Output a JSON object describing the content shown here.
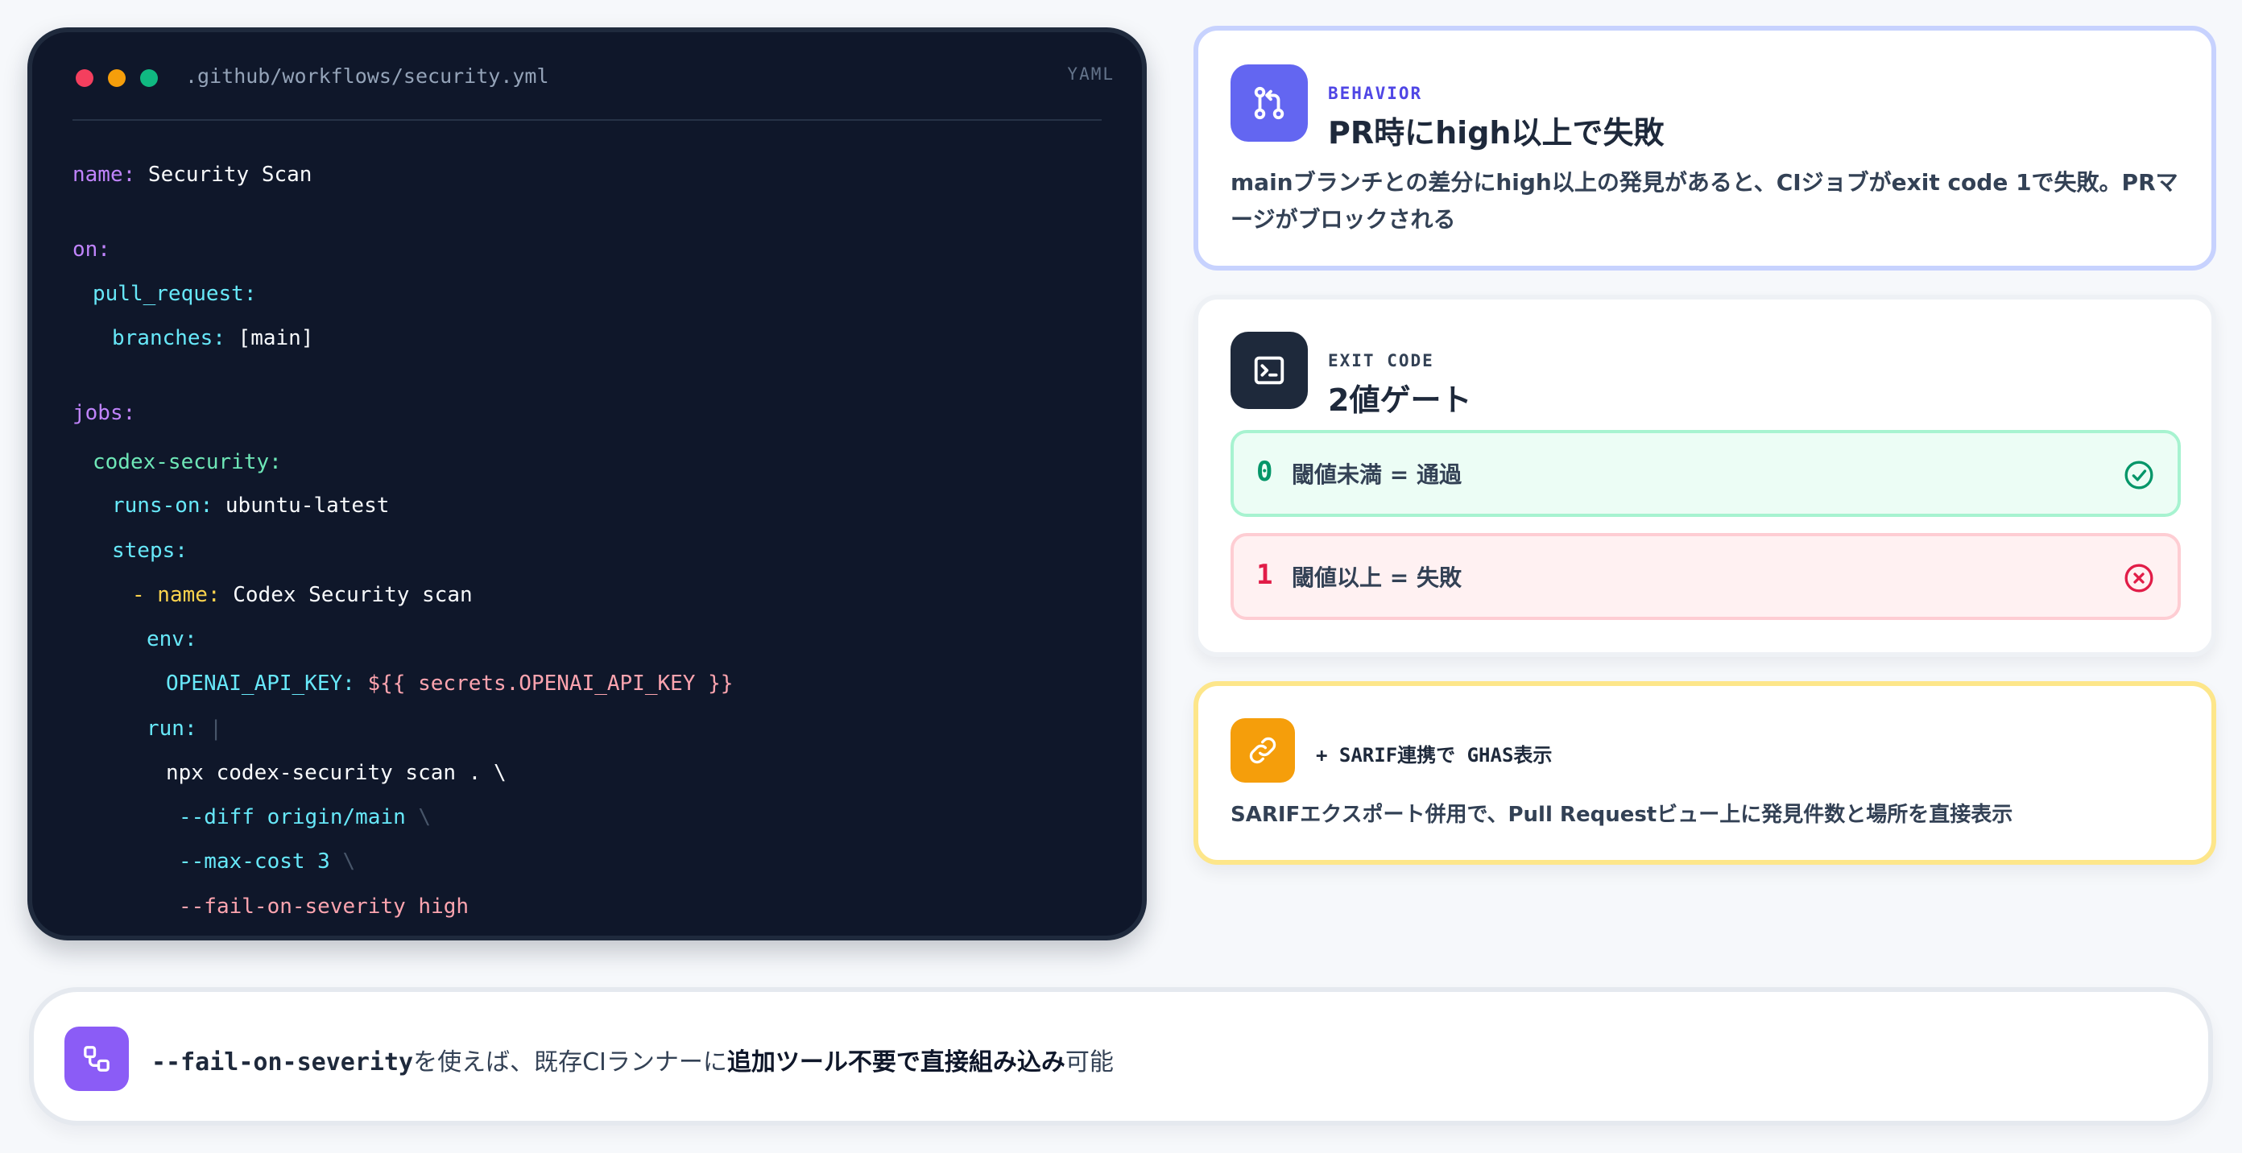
{
  "editor": {
    "filename": ".github/workflows/security.yml",
    "language": "YAML",
    "lines": [
      {
        "key": "name:",
        "value": " Security Scan"
      },
      {
        "key": "on:",
        "value": ""
      },
      {
        "key": "pull_request:",
        "value": ""
      },
      {
        "key": "branches:",
        "value": " [main]"
      },
      {
        "key": "jobs:",
        "value": ""
      },
      {
        "key": "codex-security:",
        "value": ""
      },
      {
        "key": "runs-on:",
        "value": " ubuntu-latest"
      },
      {
        "key": "steps:",
        "value": ""
      },
      {
        "key": "- name:",
        "value": " Codex Security scan"
      },
      {
        "key": "env:",
        "value": ""
      },
      {
        "key": "OPENAI_API_KEY:",
        "value": " ${{ secrets.OPENAI_API_KEY }}"
      },
      {
        "key": "run:",
        "value": " |"
      },
      {
        "key": "",
        "value": "npx codex-security scan . \\"
      },
      {
        "key": "--diff origin/main",
        "value": " \\"
      },
      {
        "key": "--max-cost 3",
        "value": " \\"
      },
      {
        "key": "--fail-on-severity high",
        "value": ""
      }
    ]
  },
  "behavior": {
    "eyebrow": "BEHAVIOR",
    "title": "PR時にhigh以上で失敗",
    "description": "mainブランチとの差分にhigh以上の発見があると、CIジョブがexit code 1で失敗。PRマージがブロックされる",
    "icon": "git-pull-request-icon",
    "accent": "#6366f1"
  },
  "exit_code": {
    "eyebrow": "EXIT CODE",
    "title": "2値ゲート",
    "icon": "terminal-icon",
    "rows": [
      {
        "code": "0",
        "label": "閾値未満 = 通過",
        "status": "pass",
        "color": "#059669"
      },
      {
        "code": "1",
        "label": "閾値以上 = 失敗",
        "status": "fail",
        "color": "#e11d48"
      }
    ]
  },
  "sarif": {
    "title": "+ SARIF連携で GHAS表示",
    "description": "SARIFエクスポート併用で、Pull Requestビュー上に発見件数と場所を直接表示",
    "icon": "link-icon",
    "accent": "#f59e0b"
  },
  "footer": {
    "flag": "--fail-on-severity",
    "text_1": "を使えば、既存CIランナーに",
    "emphasis": "追加ツール不要で直接組み込み",
    "text_2": "可能",
    "icon": "workflow-icon"
  }
}
